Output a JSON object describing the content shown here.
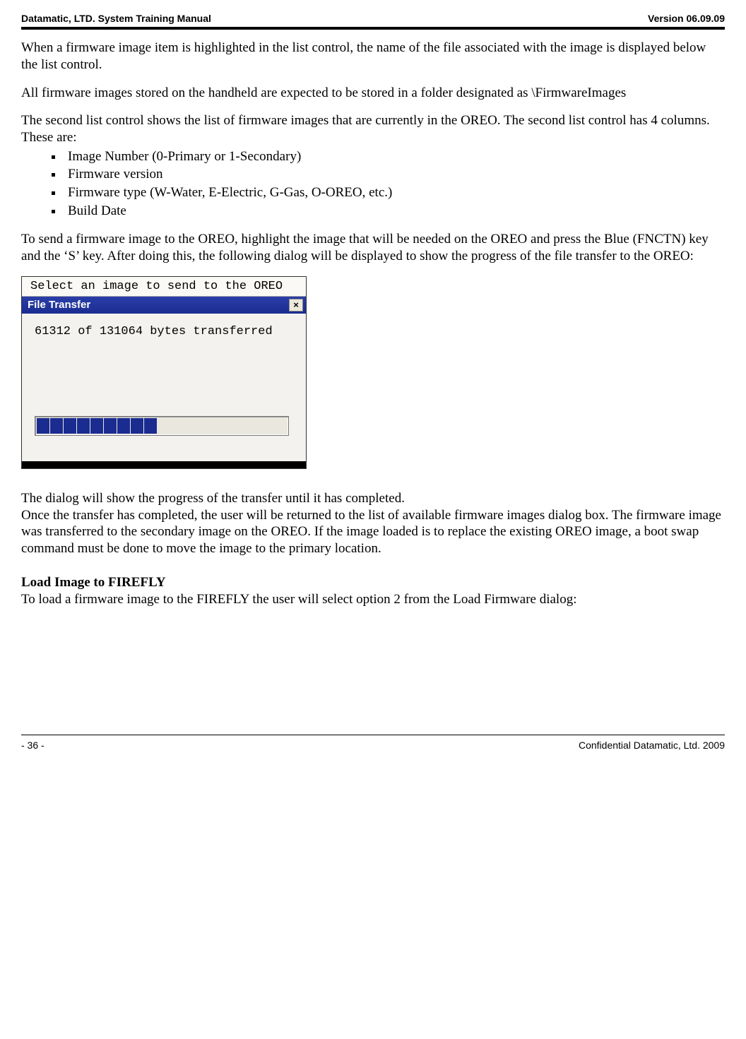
{
  "header": {
    "left": "Datamatic, LTD. System Training  Manual",
    "right": "Version 06.09.09"
  },
  "paras": {
    "p1": "When a firmware image item is highlighted in the list control, the name of the file associated with the image is displayed below the list control.",
    "p2": "All firmware images stored on the handheld are expected to be stored in a folder designated as \\FirmwareImages",
    "p3": "The second list control shows the list of firmware images that are currently in the OREO.  The second list control has 4 columns.  These are:",
    "bullets": [
      "Image Number (0-Primary or 1-Secondary)",
      "Firmware version",
      "Firmware type (W-Water, E-Electric, G-Gas, O-OREO, etc.)",
      "Build Date"
    ],
    "p4": "To send a firmware image to the OREO, highlight the image that will be needed on the OREO and press the Blue (FNCTN) key and the ‘S’ key.  After doing this, the following dialog will be displayed to show the progress of the file transfer to the OREO:",
    "p5": "The dialog will show the progress of the transfer until it has completed.",
    "p6": "Once the transfer has completed, the user will be returned to the list of available firmware images dialog box.  The firmware image was transferred to the secondary image on the OREO.  If the image loaded is to replace the existing OREO image, a boot swap command must be done to move the image to the primary location.",
    "h1": "Load Image to FIREFLY",
    "p7": "To load a firmware image to the FIREFLY the user will select option 2 from the Load Firmware dialog:"
  },
  "dialog": {
    "top_label": "Select an image to send to the OREO",
    "title": "File Transfer",
    "close_glyph": "×",
    "status": "61312 of 131064 bytes transferred",
    "progress_blocks": 9
  },
  "footer": {
    "left": "- 36 -",
    "right": "Confidential Datamatic, Ltd. 2009"
  }
}
